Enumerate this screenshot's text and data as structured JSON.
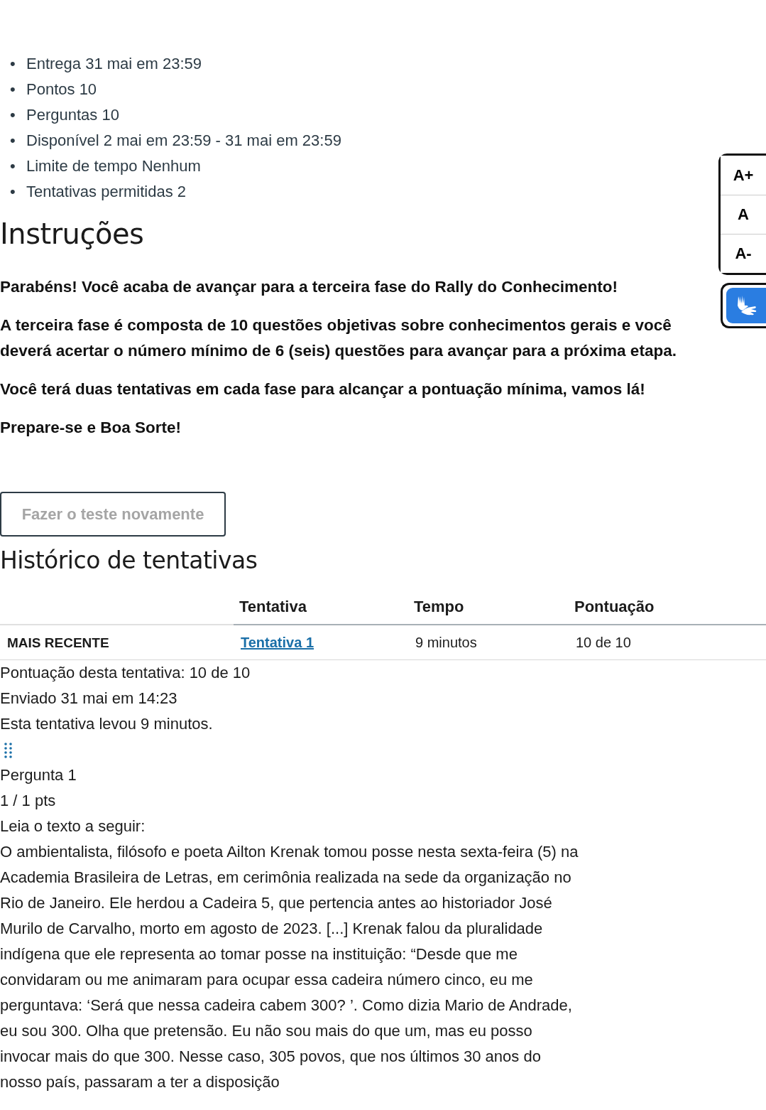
{
  "bullet": "•",
  "details": [
    {
      "label": "Entrega",
      "value": "31 mai em 23:59"
    },
    {
      "label": "Pontos",
      "value": "10"
    },
    {
      "label": "Perguntas",
      "value": "10"
    },
    {
      "label": "Disponível",
      "value": "2 mai em 23:59 - 31 mai em 23:59"
    },
    {
      "label": "Limite de tempo",
      "value": "Nenhum"
    },
    {
      "label": "Tentativas permitidas",
      "value": "2"
    }
  ],
  "instructions": {
    "title": "Instruções",
    "paragraphs": [
      "Parabéns! Você acaba de avançar para a terceira fase do Rally do Conhecimento!",
      "A terceira fase é composta de 10 questões objetivas sobre conhecimentos gerais e você deverá acertar o número mínimo de 6 (seis) questões para avançar para a próxima etapa.",
      "Você terá duas tentativas em cada fase para alcançar a pontuação mínima, vamos lá!",
      "Prepare-se e Boa Sorte!"
    ]
  },
  "retake_button": {
    "label": "Fazer o teste novamente",
    "disabled": true
  },
  "history": {
    "title": "Histórico de tentativas",
    "columns": [
      "Tentativa",
      "Tempo",
      "Pontuação"
    ],
    "rows": [
      {
        "tag": "MAIS RECENTE",
        "attempt": "Tentativa 1",
        "time": "9 minutos",
        "score": "10 de 10"
      }
    ]
  },
  "summary": [
    "Pontuação desta tentativa: 10 de 10",
    "Enviado 31 mai em 14:23",
    "Esta tentativa levou 9 minutos."
  ],
  "question": {
    "title": "Pergunta 1",
    "points": "1 / 1 pts",
    "prompt": "Leia o texto a seguir:",
    "passage": "O ambientalista, filósofo e poeta Ailton Krenak tomou posse nesta sexta-feira (5) na Academia Brasileira de Letras, em cerimônia realizada na sede da organização no Rio de Janeiro. Ele herdou a Cadeira 5, que pertencia antes ao historiador José Murilo de Carvalho, morto em agosto de 2023. [...] Krenak falou da pluralidade indígena que ele representa ao tomar posse na instituição: “Desde que me convidaram ou me animaram para ocupar essa cadeira número cinco, eu me perguntava: ‘Será que nessa cadeira cabem 300? ’. Como dizia Mario de Andrade, eu sou 300. Olha que pretensão. Eu não sou mais do que um, mas eu posso invocar mais do que 300. Nesse caso, 305 povos, que nos últimos 30 anos do nosso país, passaram a ter a disposição"
  },
  "font_controls": [
    "A+",
    "A",
    "A-"
  ]
}
